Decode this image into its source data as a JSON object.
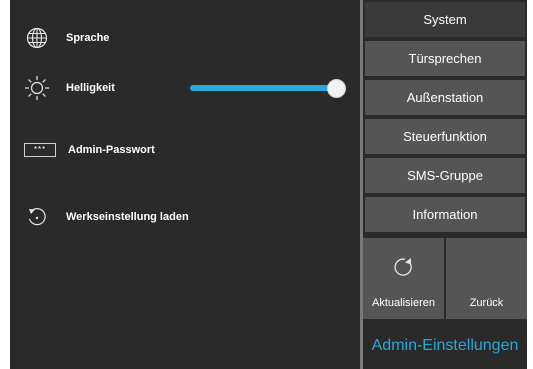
{
  "settings": {
    "language_label": "Sprache",
    "brightness_label": "Helligkeit",
    "brightness_level_percent": 100,
    "password_icon_text": "***",
    "password_label": "Admin-Passwort",
    "factory_reset_label": "Werkseinstellung laden"
  },
  "menu": {
    "items": [
      {
        "label": "System"
      },
      {
        "label": "Türsprechen"
      },
      {
        "label": "Außenstation"
      },
      {
        "label": "Steuerfunktion"
      },
      {
        "label": "SMS-Gruppe"
      },
      {
        "label": "Information"
      }
    ],
    "refresh_label": "Aktualisieren",
    "back_label": "Zurück",
    "title": "Admin-Einstellungen"
  },
  "colors": {
    "accent": "#29a8dc",
    "background": "#2a2a2a",
    "button": "#555555"
  },
  "icons": [
    "globe-icon",
    "sun-icon",
    "password-icon",
    "reset-icon",
    "refresh-icon"
  ]
}
